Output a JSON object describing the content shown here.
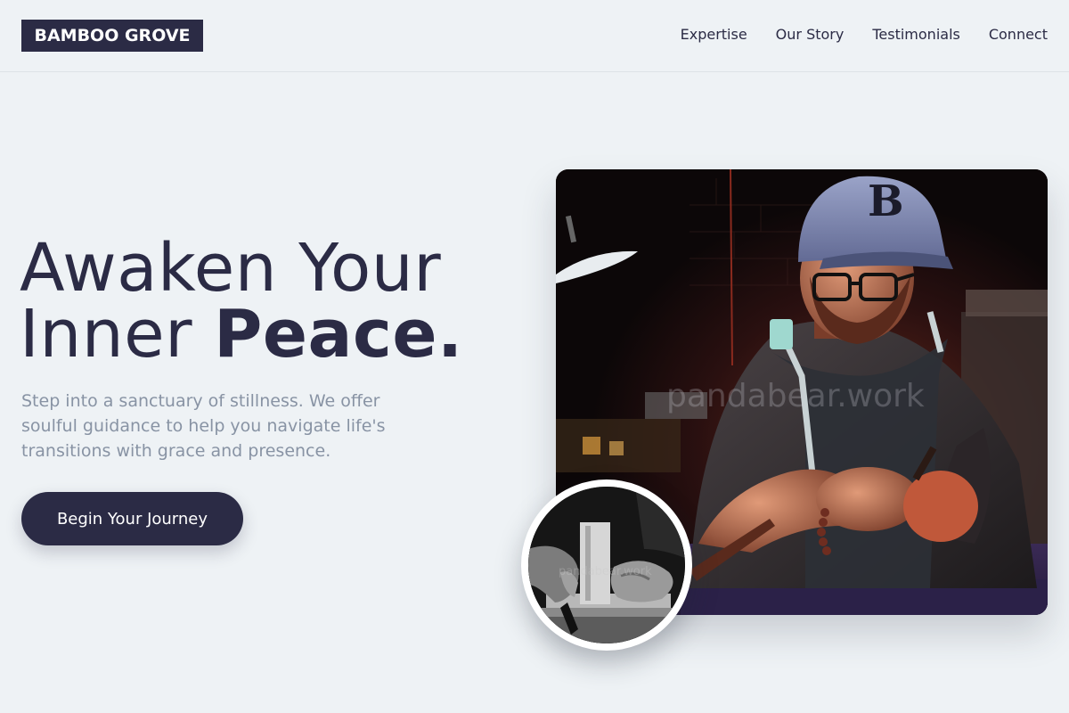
{
  "header": {
    "logo": "BAMBOO GROVE",
    "nav": [
      {
        "label": "Expertise"
      },
      {
        "label": "Our Story"
      },
      {
        "label": "Testimonials"
      },
      {
        "label": "Connect"
      }
    ]
  },
  "hero": {
    "title_line1": "Awaken Your",
    "title_line2_regular": "Inner ",
    "title_line2_bold": "Peace.",
    "subtitle": "Step into a sanctuary of stillness. We offer soulful guidance to help you navigate life's transitions with grace and presence.",
    "cta_label": "Begin Your Journey"
  },
  "images": {
    "main_watermark": "pandabear.work",
    "circle_watermark": "pandabear.work"
  },
  "colors": {
    "background": "#eef2f5",
    "primary": "#2b2b45",
    "muted_text": "#8893a4",
    "white": "#ffffff"
  }
}
